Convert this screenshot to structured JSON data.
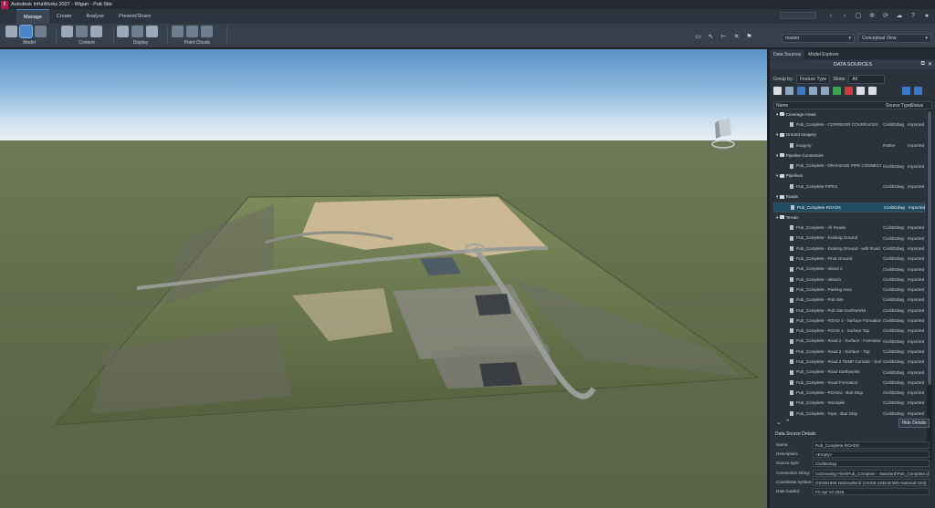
{
  "app": {
    "title": "Autodesk InfraWorks 2027 - Wigan - Pub Site",
    "icon_letter": "I"
  },
  "ribbon_tabs": [
    "Manage",
    "Create",
    "Analyse",
    "Present/Share"
  ],
  "ribbon_groups": {
    "model": "Model",
    "content": "Content",
    "display": "Display",
    "point_clouds": "Point Clouds"
  },
  "view": {
    "proposal": "master",
    "visual_style": "Conceptual View"
  },
  "panel": {
    "tabs": [
      "Data Sources",
      "Model Explorer"
    ],
    "title": "DATA SOURCES",
    "group_by_label": "Group by:",
    "group_by_value": "Feature Type",
    "show_label": "Show:",
    "show_value": "All",
    "columns": {
      "name": "Name",
      "source_type": "Source Type",
      "status": "Status"
    },
    "rows": [
      {
        "kind": "group",
        "name": "Coverage Areas"
      },
      {
        "kind": "item",
        "name": "Pub_Complete - CORRIDOR COVERAGES",
        "type": "Civil3Ddwg",
        "status": "Imported"
      },
      {
        "kind": "group",
        "name": "Ground Imagery"
      },
      {
        "kind": "item",
        "name": "Imagery",
        "type": "Raster",
        "status": "Imported"
      },
      {
        "kind": "group",
        "name": "Pipeline Connectors"
      },
      {
        "kind": "item",
        "name": "Pub_Complete - DRAINAGE PIPE CONNECTOR",
        "type": "Civil3Ddwg",
        "status": "Imported"
      },
      {
        "kind": "group",
        "name": "Pipelines"
      },
      {
        "kind": "item",
        "name": "Pub_Complete PIPES",
        "type": "Civil3Ddwg",
        "status": "Imported"
      },
      {
        "kind": "group",
        "name": "Roads"
      },
      {
        "kind": "item",
        "name": "Pub_Complete ROADS",
        "type": "Civil3Ddwg",
        "status": "Imported",
        "selected": true
      },
      {
        "kind": "group",
        "name": "Terrain"
      },
      {
        "kind": "item",
        "name": "Pub_Complete - All Roads",
        "type": "Civil3Ddwg",
        "status": "Imported"
      },
      {
        "kind": "item",
        "name": "Pub_Complete - Existing Ground",
        "type": "Civil3Ddwg",
        "status": "Imported"
      },
      {
        "kind": "item",
        "name": "Pub_Complete - Existing Ground - with Road",
        "type": "Civil3Ddwg",
        "status": "Imported"
      },
      {
        "kind": "item",
        "name": "Pub_Complete - Final Ground",
        "type": "Civil3Ddwg",
        "status": "Imported"
      },
      {
        "kind": "item",
        "name": "Pub_Complete - Island 2",
        "type": "Civil3Ddwg",
        "status": "Imported"
      },
      {
        "kind": "item",
        "name": "Pub_Complete - Island1",
        "type": "Civil3Ddwg",
        "status": "Imported"
      },
      {
        "kind": "item",
        "name": "Pub_Complete - Parking Area",
        "type": "Civil3Ddwg",
        "status": "Imported"
      },
      {
        "kind": "item",
        "name": "Pub_Complete - Pub Site",
        "type": "Civil3Ddwg",
        "status": "Imported"
      },
      {
        "kind": "item",
        "name": "Pub_Complete - Pub Site Earthworks",
        "type": "Civil3Ddwg",
        "status": "Imported"
      },
      {
        "kind": "item",
        "name": "Pub_Complete - ROAD 1 - Surface Formation",
        "type": "Civil3Ddwg",
        "status": "Imported"
      },
      {
        "kind": "item",
        "name": "Pub_Complete - ROAD 1 - Surface Top",
        "type": "Civil3Ddwg",
        "status": "Imported"
      },
      {
        "kind": "item",
        "name": "Pub_Complete - Road 2 - Surface - Formation",
        "type": "Civil3Ddwg",
        "status": "Imported"
      },
      {
        "kind": "item",
        "name": "Pub_Complete - Road 2 - Surface - Top",
        "type": "Civil3Ddwg",
        "status": "Imported"
      },
      {
        "kind": "item",
        "name": "Pub_Complete - Road 2 TEMP Corridor - Surface",
        "type": "Civil3Ddwg",
        "status": "Imported"
      },
      {
        "kind": "item",
        "name": "Pub_Complete - Road Earthworks",
        "type": "Civil3Ddwg",
        "status": "Imported"
      },
      {
        "kind": "item",
        "name": "Pub_Complete - Road Formation",
        "type": "Civil3Ddwg",
        "status": "Imported"
      },
      {
        "kind": "item",
        "name": "Pub_Complete - ROAD1 - Bus Stop",
        "type": "Civil3Ddwg",
        "status": "Imported"
      },
      {
        "kind": "item",
        "name": "Pub_Complete - Stockpile",
        "type": "Civil3Ddwg",
        "status": "Imported"
      },
      {
        "kind": "item",
        "name": "Pub_Complete - Topo - Bus Stop",
        "type": "Civil3Ddwg",
        "status": "Imported"
      }
    ],
    "hide_details": "Hide Details",
    "details_title": "Data Source Details",
    "details": [
      {
        "label": "Name:",
        "value": "Pub_Complete ROADS"
      },
      {
        "label": "Description:",
        "value": "<Empty>"
      },
      {
        "label": "Source type:",
        "value": "Civil3Ddwg"
      },
      {
        "label": "Connection string:",
        "value": "\\ocDrawing Files\\Pub_Complete - Standard\\Pub_Complete.dwg"
      },
      {
        "label": "Coordinate system:",
        "value": "OSGB1936.NationalGrid (OSGB 1936 British National Grid)"
      },
      {
        "label": "Date loaded:",
        "value": "Fri Apr 10 2026"
      }
    ]
  },
  "colors": {
    "accent": "#4d86c6",
    "selected_row": "#1f4c61",
    "brand": "#b01b55"
  }
}
